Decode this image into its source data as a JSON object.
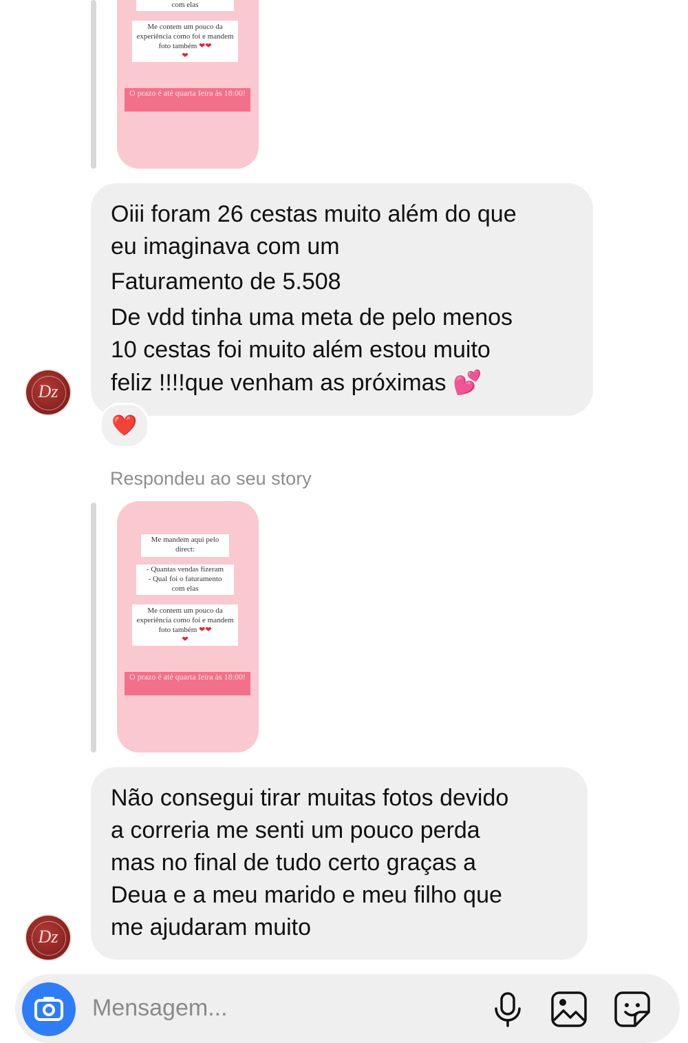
{
  "story_card": {
    "box1": "Me mandem aqui pelo direct:",
    "box2_line1": "- Quantas vendas fizeram",
    "box2_line2": "- Qual foi o faturamento",
    "box2_line3": "com elas",
    "box3": "Me contem um pouco da experiência como foi e mandem foto também",
    "heart_glyph": "❤️",
    "deadline": "O prazo é até quarta feira às 18:00!"
  },
  "messages": [
    {
      "lines": [
        "Oiii foram 26 cestas muito além do que",
        "eu imaginava com um",
        "Faturamento de 5.508",
        "De vdd tinha uma meta de pelo menos",
        "10 cestas foi muito além estou muito",
        "feliz !!!!que venham as próximas 💕"
      ],
      "reaction": "❤️"
    },
    {
      "lines": [
        "Não consegui tirar muitas fotos devido",
        "a correria me senti um pouco perda",
        "mas no final de tudo certo graças a",
        "Deua e a meu marido e meu filho que",
        "me ajudaram muito"
      ]
    }
  ],
  "reply_label": "Respondeu ao seu story",
  "composer": {
    "placeholder": "Mensagem...",
    "icons": [
      "camera-icon",
      "microphone-icon",
      "gallery-icon",
      "sticker-icon"
    ]
  },
  "colors": {
    "story_bg": "#f9c9cf",
    "deadline_bar": "#f2708a",
    "bubble_bg": "#efefef",
    "camera_blue": "#2f7df6"
  }
}
